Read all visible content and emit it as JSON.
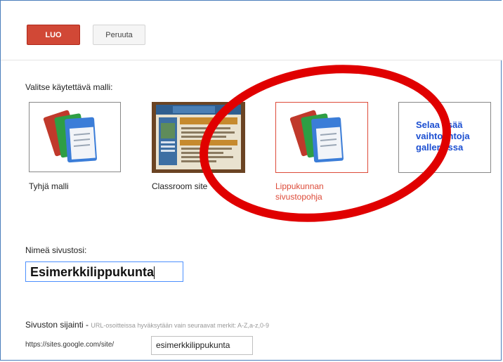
{
  "toolbar": {
    "create_label": "LUO",
    "cancel_label": "Peruuta"
  },
  "template_section": {
    "heading": "Valitse käytettävä malli:",
    "templates": [
      {
        "caption": "Tyhjä malli",
        "icon": "site-pages-icon",
        "selected": false
      },
      {
        "caption": "Classroom site",
        "icon": "classroom-thumbnail",
        "selected": false
      },
      {
        "caption_line1": "Lippukunnan",
        "caption_line2": "sivustopohja",
        "icon": "site-pages-icon",
        "selected": true
      }
    ],
    "more_link_line1": "Selaa lisää",
    "more_link_line2": "vaihtoehtoja",
    "more_link_line3": "galleriassa"
  },
  "name_section": {
    "label": "Nimeä sivustosi:",
    "value": "Esimerkkilippukunta"
  },
  "location_section": {
    "label": "Sivuston sijainti",
    "separator": " - ",
    "hint": "URL-osoitteissa hyväksytään vain seuraavat merkit: A-Z,a-z,0-9",
    "url_prefix": "https://sites.google.com/site/",
    "url_value": "esimerkkilippukunta"
  },
  "colors": {
    "create_button": "#d14836",
    "selected_border": "#dd4b39",
    "link_blue": "#1c4fd1",
    "annotation_red": "#e00000"
  }
}
